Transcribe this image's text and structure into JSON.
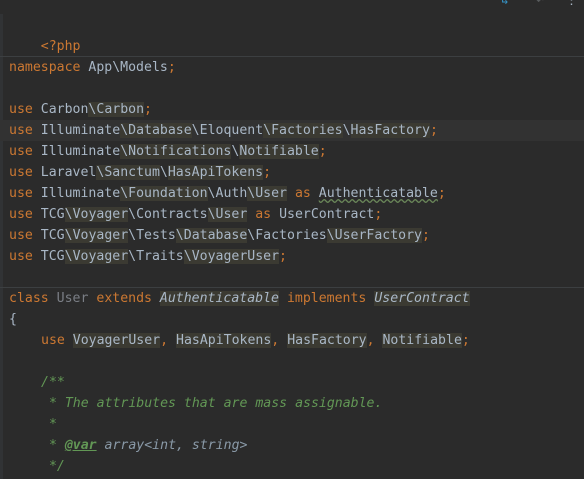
{
  "toolbar": {
    "arrow_icon": "↳",
    "undo_icon": "↶",
    "more_icon": "⋮",
    "accent": "#3592c4"
  },
  "colors": {
    "background": "#2b2b2b",
    "keyword": "#cc7832",
    "text": "#a9b7c6",
    "comment": "#629755",
    "highlight": "#3b3a32"
  },
  "code": {
    "php_open": "<?php",
    "namespace_kw": "namespace",
    "namespace_name": "App\\Models",
    "use_kw": "use",
    "as_kw": "as",
    "semicolon": ";",
    "imports": [
      {
        "parts": [
          "Carbon",
          "Carbon"
        ]
      },
      {
        "parts": [
          "Illuminate",
          "Database",
          "Eloquent",
          "Factories",
          "HasFactory"
        ]
      },
      {
        "parts": [
          "Illuminate",
          "Notifications",
          "Notifiable"
        ]
      },
      {
        "parts": [
          "Laravel",
          "Sanctum",
          "HasApiTokens"
        ]
      },
      {
        "parts": [
          "Illuminate",
          "Foundation",
          "Auth",
          "User"
        ],
        "alias": "Authenticatable"
      },
      {
        "parts": [
          "TCG",
          "Voyager",
          "Contracts",
          "User"
        ],
        "alias": "UserContract"
      },
      {
        "parts": [
          "TCG",
          "Voyager",
          "Tests",
          "Database",
          "Factories",
          "UserFactory"
        ]
      },
      {
        "parts": [
          "TCG",
          "Voyager",
          "Traits",
          "VoyagerUser"
        ]
      }
    ],
    "class_kw": "class",
    "class_name": "User",
    "extends_kw": "extends",
    "extends_name": "Authenticatable",
    "implements_kw": "implements",
    "implements_name": "UserContract",
    "open_brace": "{",
    "traits": [
      "VoyagerUser",
      "HasApiTokens",
      "HasFactory",
      "Notifiable"
    ],
    "comment_open": "/**",
    "comment_text": " * The attributes that are mass assignable.",
    "comment_star": " *",
    "comment_var_tag": "@var",
    "comment_var_type": " array<int, string>",
    "comment_close": " */"
  }
}
